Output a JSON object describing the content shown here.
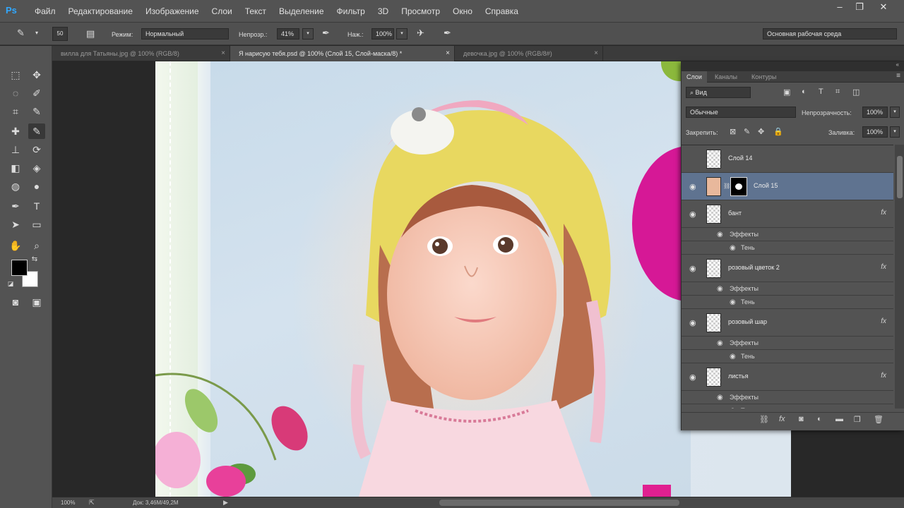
{
  "app": {
    "logo": "Ps"
  },
  "menu": [
    "Файл",
    "Редактирование",
    "Изображение",
    "Слои",
    "Текст",
    "Выделение",
    "Фильтр",
    "3D",
    "Просмотр",
    "Окно",
    "Справка"
  ],
  "window_controls": {
    "minimize": "–",
    "restore": "❐",
    "close": "✕"
  },
  "options_bar": {
    "brush_size": "50",
    "mode_label": "Режим:",
    "mode_value": "Нормальный",
    "opacity_label": "Непрозр.:",
    "opacity_value": "41%",
    "flow_label": "Наж.:",
    "flow_value": "100%",
    "workspace": "Основная рабочая среда"
  },
  "doc_tabs": [
    {
      "label": "вилла для Татьяны.jpg @ 100% (RGB/8)",
      "close": "×"
    },
    {
      "label": "Я нарисую тебя.psd @ 100% (Слой 15, Слой-маска/8) *",
      "close": "×"
    },
    {
      "label": "девочка.jpg @ 100% (RGB/8#)",
      "close": "×"
    }
  ],
  "status": {
    "zoom": "100%",
    "doc_size": "Док: 3,46M/49,2M",
    "play": "▶"
  },
  "layers_panel": {
    "collapse": "«",
    "tabs": [
      "Слои",
      "Каналы",
      "Контуры"
    ],
    "menu_icon": "≡",
    "filter_kind": "Вид",
    "blend_mode": "Обычные",
    "opacity_label": "Непрозрачность:",
    "opacity_value": "100%",
    "lock_label": "Закрепить:",
    "fill_label": "Заливка:",
    "fill_value": "100%",
    "effects_label": "Эффекты",
    "shadow_label": "Тень",
    "layers": [
      {
        "name": "Слой 14",
        "visible": false,
        "fx": ""
      },
      {
        "name": "Слой 15",
        "visible": true,
        "fx": ""
      },
      {
        "name": "бант",
        "visible": true,
        "fx": "fx"
      },
      {
        "name": "розовый цветок 2",
        "visible": true,
        "fx": "fx"
      },
      {
        "name": "розовый шар",
        "visible": true,
        "fx": "fx"
      },
      {
        "name": "листья",
        "visible": true,
        "fx": "fx"
      }
    ]
  },
  "colors": {
    "foreground": "#000000",
    "background": "#ffffff",
    "selected_layer": "#5f7390",
    "accent": "#31a8ff"
  }
}
